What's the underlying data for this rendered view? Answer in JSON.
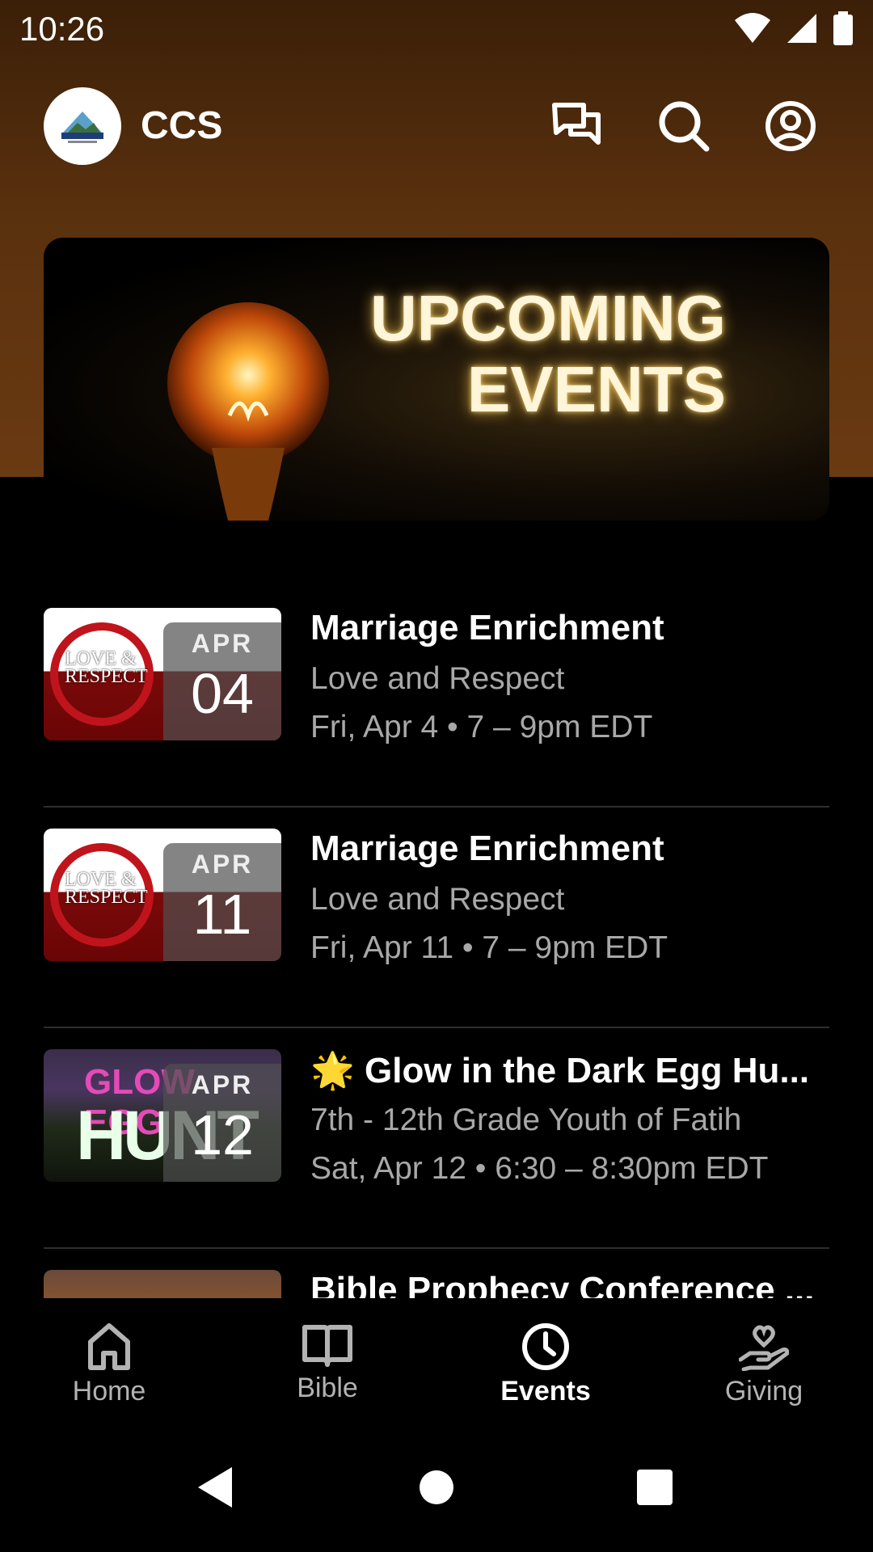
{
  "status_bar": {
    "time": "10:26"
  },
  "header": {
    "app_name": "CCS"
  },
  "banner": {
    "line1": "UPCOMING",
    "line2": "EVENTS"
  },
  "events": [
    {
      "month": "APR",
      "day": "04",
      "title": "Marriage Enrichment",
      "subtitle": "Love and Respect",
      "datetime": "Fri, Apr 4 • 7 – 9pm EDT",
      "thumb_text1": "LOVE &",
      "thumb_text2": "RESPECT"
    },
    {
      "month": "APR",
      "day": "11",
      "title": "Marriage Enrichment",
      "subtitle": "Love and Respect",
      "datetime": "Fri, Apr 11 • 7 – 9pm EDT",
      "thumb_text1": "LOVE &",
      "thumb_text2": "RESPECT"
    },
    {
      "month": "APR",
      "day": "12",
      "title": "🌟 Glow in the Dark Egg Hu...",
      "subtitle": "7th - 12th Grade Youth of Fatih",
      "datetime": "Sat, Apr 12 • 6:30 – 8:30pm EDT",
      "thumb_text1": "GLOW EGG",
      "thumb_text2": "HUNT"
    },
    {
      "title": "Bible Prophecy Conference ..."
    }
  ],
  "nav": {
    "home": "Home",
    "bible": "Bible",
    "events": "Events",
    "giving": "Giving"
  },
  "colors": {
    "header_bg": "#5a310e",
    "background": "#000000",
    "muted_text": "#a8a8a8"
  }
}
